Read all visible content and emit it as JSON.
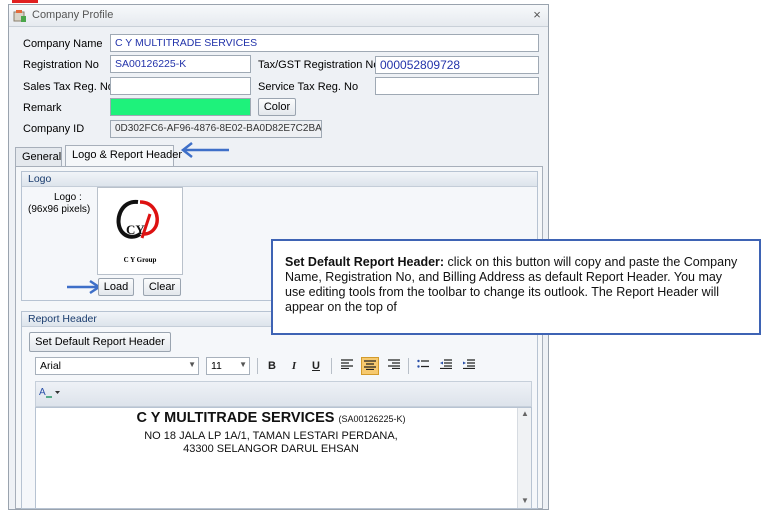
{
  "window": {
    "title": "Company Profile",
    "close_glyph": "×"
  },
  "form": {
    "company_name_label": "Company Name",
    "company_name_value": "C Y MULTITRADE SERVICES",
    "registration_no_label": "Registration No",
    "registration_no_value": "SA00126225-K",
    "tax_gst_label": "Tax/GST Registration No",
    "tax_gst_value": "000052809728",
    "sales_tax_label": "Sales Tax Reg. No",
    "sales_tax_value": "",
    "service_tax_label": "Service Tax Reg. No",
    "service_tax_value": "",
    "remark_label": "Remark",
    "remark_color": "#1ef27b",
    "color_button": "Color",
    "company_id_label": "Company ID",
    "company_id_value": "0D302FC6-AF96-4876-8E02-BA0D82E7C2BA"
  },
  "tabs": [
    {
      "label": "General"
    },
    {
      "label": "Logo & Report Header"
    }
  ],
  "logo_group": {
    "title": "Logo",
    "caption_line1": "Logo :",
    "caption_line2": "(96x96 pixels)",
    "logo_letters": "CY",
    "logo_text": "C Y Group",
    "load_button": "Load",
    "clear_button": "Clear"
  },
  "report_header_group": {
    "title": "Report Header",
    "default_button": "Set Default Report Header",
    "font_name": "Arial",
    "font_size": "11",
    "bold": "B",
    "italic": "I",
    "underline": "U",
    "header_name": "C Y MULTITRADE SERVICES",
    "header_reg": "(SA00126225-K)",
    "header_address1": "NO 18 JALA LP 1A/1, TAMAN LESTARI PERDANA,",
    "header_address2": "43300 SELANGOR DARUL EHSAN"
  },
  "callout": {
    "bold_text": "Set Default Report Header:",
    "body_text": " click on this button will copy and paste the Company Name, Registration No, and Billing Address as default Report Header. You may use editing tools from the toolbar to change its outlook. The Report Header will appear on the top of"
  },
  "colors": {
    "accent": "#3e63b4",
    "arrow": "#3e6fc8",
    "remark": "#1ef27b"
  },
  "icons": [
    "app-icon",
    "close-icon",
    "arrow-icon",
    "combo-arrow-icon",
    "align-left-icon",
    "align-center-icon",
    "align-right-icon",
    "bullet-list-icon",
    "outdent-icon",
    "indent-icon",
    "text-color-icon"
  ]
}
